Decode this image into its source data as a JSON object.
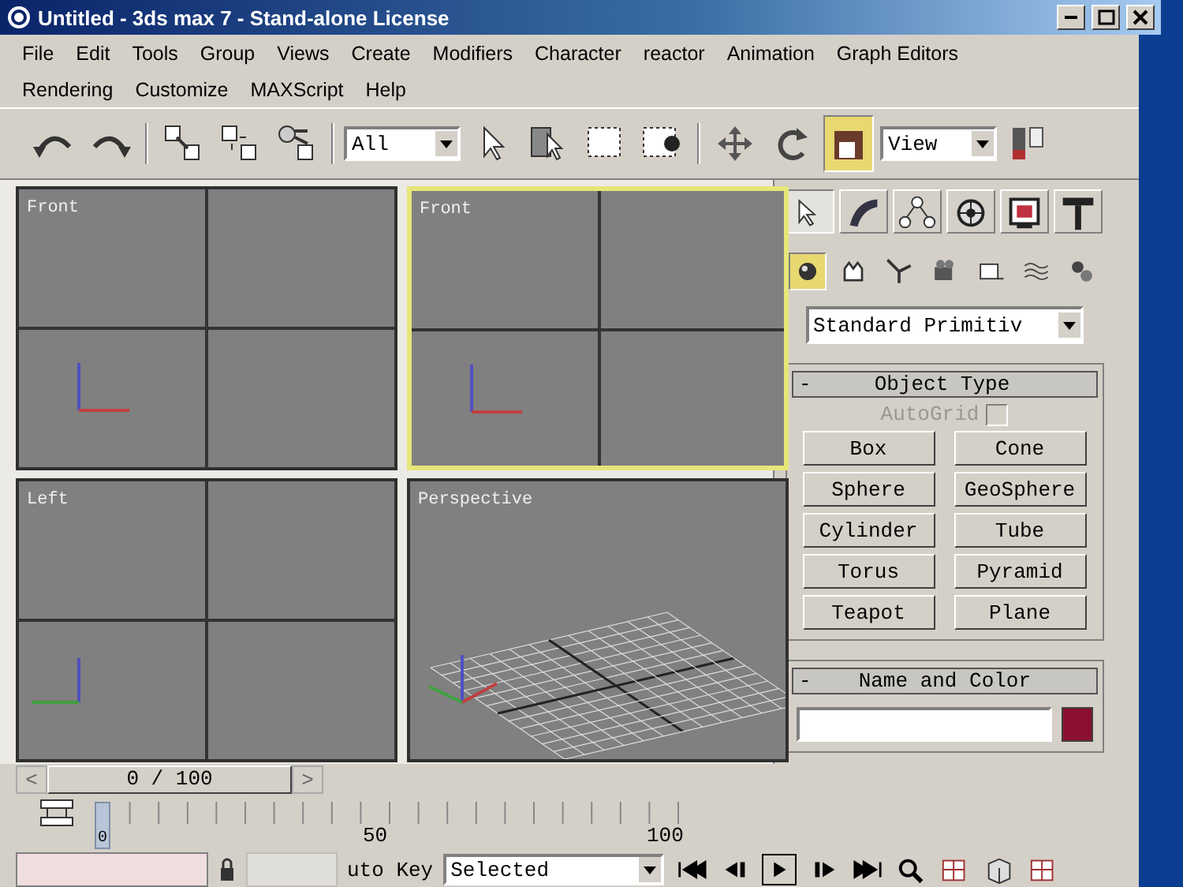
{
  "window": {
    "title": "Untitled - 3ds max 7  - Stand-alone License"
  },
  "menu_rows": [
    [
      "File",
      "Edit",
      "Tools",
      "Group",
      "Views",
      "Create",
      "Modifiers",
      "Character",
      "reactor",
      "Animation",
      "Graph Editors"
    ],
    [
      "Rendering",
      "Customize",
      "MAXScript",
      "Help"
    ]
  ],
  "toolbar": {
    "items": [
      {
        "kind": "undo",
        "selected": false
      },
      {
        "kind": "redo",
        "selected": false
      },
      {
        "kind": "separator"
      },
      {
        "kind": "link",
        "selected": false
      },
      {
        "kind": "unlink",
        "selected": false
      },
      {
        "kind": "bind",
        "selected": false
      },
      {
        "kind": "separator"
      },
      {
        "kind": "dropdown",
        "value": "All"
      },
      {
        "kind": "select",
        "selected": false
      },
      {
        "kind": "select-by-name",
        "selected": false
      },
      {
        "kind": "rect-region",
        "selected": false
      },
      {
        "kind": "window-crossing",
        "selected": false
      },
      {
        "kind": "separator"
      },
      {
        "kind": "move",
        "selected": false
      },
      {
        "kind": "rotate",
        "selected": false
      },
      {
        "kind": "scale",
        "selected": true
      },
      {
        "kind": "dropdown",
        "value": "View"
      },
      {
        "kind": "pivot",
        "selected": false
      }
    ]
  },
  "viewports": [
    {
      "label": "Front",
      "kind": "front",
      "active": false
    },
    {
      "label": "Front",
      "kind": "front",
      "active": true
    },
    {
      "label": "Left",
      "kind": "left",
      "active": false
    },
    {
      "label": "Perspective",
      "kind": "perspective",
      "active": false
    }
  ],
  "command_panel": {
    "tabs": [
      {
        "kind": "create",
        "selected": true
      },
      {
        "kind": "modify",
        "selected": false
      },
      {
        "kind": "hierarchy",
        "selected": false
      },
      {
        "kind": "motion",
        "selected": false
      },
      {
        "kind": "display",
        "selected": false
      },
      {
        "kind": "utilities",
        "selected": false
      }
    ],
    "categories": [
      {
        "kind": "geometry",
        "selected": true
      },
      {
        "kind": "shapes",
        "selected": false
      },
      {
        "kind": "lights",
        "selected": false
      },
      {
        "kind": "cameras",
        "selected": false
      },
      {
        "kind": "helpers",
        "selected": false
      },
      {
        "kind": "space-warps",
        "selected": false
      },
      {
        "kind": "systems",
        "selected": false
      }
    ],
    "type_dropdown": "Standard Primitiv",
    "object_type": {
      "collapse": "-",
      "title": "Object Type",
      "autogrid": {
        "label": "AutoGrid",
        "checked": false,
        "disabled": true
      },
      "buttons": [
        "Box",
        "Cone",
        "Sphere",
        "GeoSphere",
        "Cylinder",
        "Tube",
        "Torus",
        "Pyramid",
        "Teapot",
        "Plane"
      ]
    },
    "name_and_color": {
      "collapse": "-",
      "title": "Name and Color",
      "color": "#8b1030"
    }
  },
  "time_slider": {
    "prev": "<",
    "position": "0 / 100",
    "next": ">",
    "level": 0
  },
  "track_bar": {
    "frame": "0",
    "labels": [
      "50",
      "100"
    ]
  },
  "bottom_bar": {
    "auto_key": "uto Key",
    "key_filter": "Selected",
    "playback": [
      {
        "kind": "go-start"
      },
      {
        "kind": "prev-frame"
      },
      {
        "kind": "play"
      },
      {
        "kind": "next-frame"
      },
      {
        "kind": "go-end"
      }
    ],
    "navigation": [
      {
        "kind": "zoom"
      },
      {
        "kind": "zoom-all"
      },
      {
        "kind": "zoom-extents"
      },
      {
        "kind": "zoom-extents-all"
      }
    ]
  }
}
